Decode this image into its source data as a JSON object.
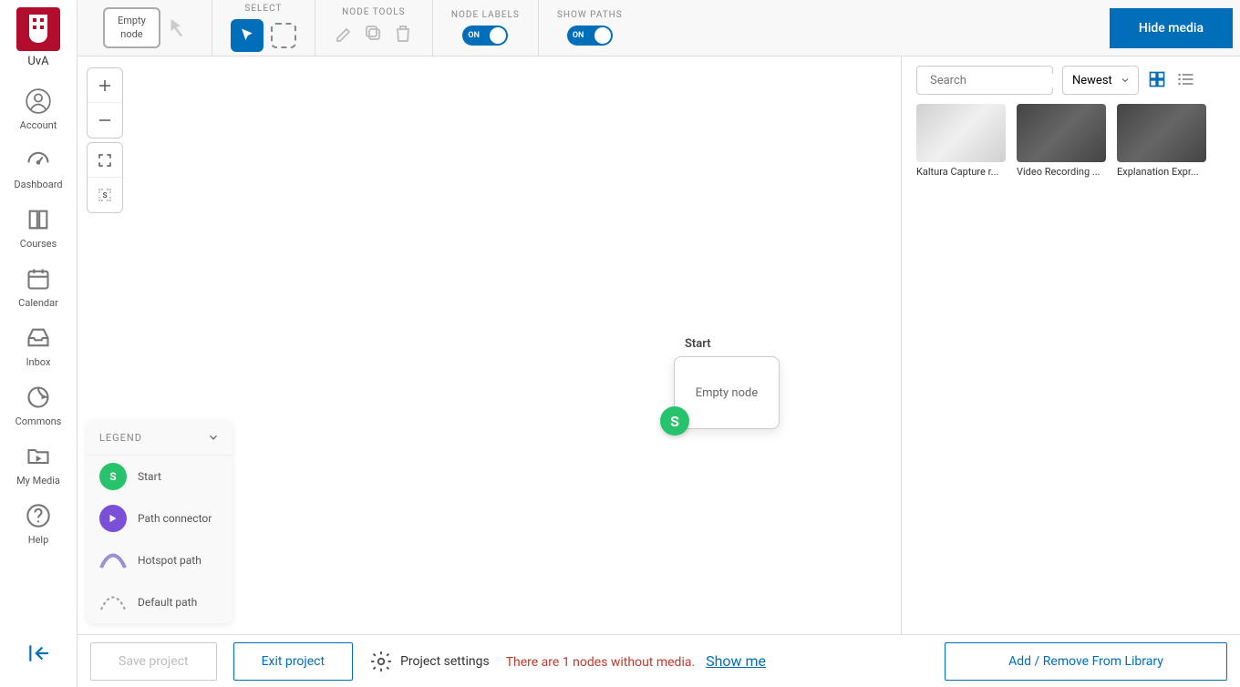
{
  "brand": {
    "short": "UvA"
  },
  "nav": {
    "items": [
      {
        "label": "Account"
      },
      {
        "label": "Dashboard"
      },
      {
        "label": "Courses"
      },
      {
        "label": "Calendar"
      },
      {
        "label": "Inbox"
      },
      {
        "label": "Commons"
      },
      {
        "label": "My Media"
      },
      {
        "label": "Help"
      }
    ]
  },
  "toolbar": {
    "empty_node_label": "Empty\nnode",
    "select_label": "SELECT",
    "node_tools_label": "NODE TOOLS",
    "node_labels_label": "NODE LABELS",
    "show_paths_label": "SHOW PATHS",
    "toggle_on": "ON",
    "hide_media_label": "Hide media"
  },
  "canvas": {
    "node_label": "Start",
    "node_text": "Empty node",
    "node_badge": "S"
  },
  "legend": {
    "title": "LEGEND",
    "items": [
      {
        "badge": "S",
        "label": "Start"
      },
      {
        "label": "Path connector"
      },
      {
        "label": "Hotspot path"
      },
      {
        "label": "Default path"
      }
    ]
  },
  "media": {
    "search_placeholder": "Search",
    "sort_selected": "Newest",
    "items": [
      {
        "title": "Kaltura Capture r..."
      },
      {
        "title": "Video Recording ..."
      },
      {
        "title": "Explanation Expr..."
      }
    ]
  },
  "footer": {
    "save_label": "Save project",
    "exit_label": "Exit project",
    "settings_label": "Project settings",
    "warning_text": "There are 1 nodes without media.",
    "show_me_label": "Show me",
    "add_remove_label": "Add / Remove From Library"
  }
}
